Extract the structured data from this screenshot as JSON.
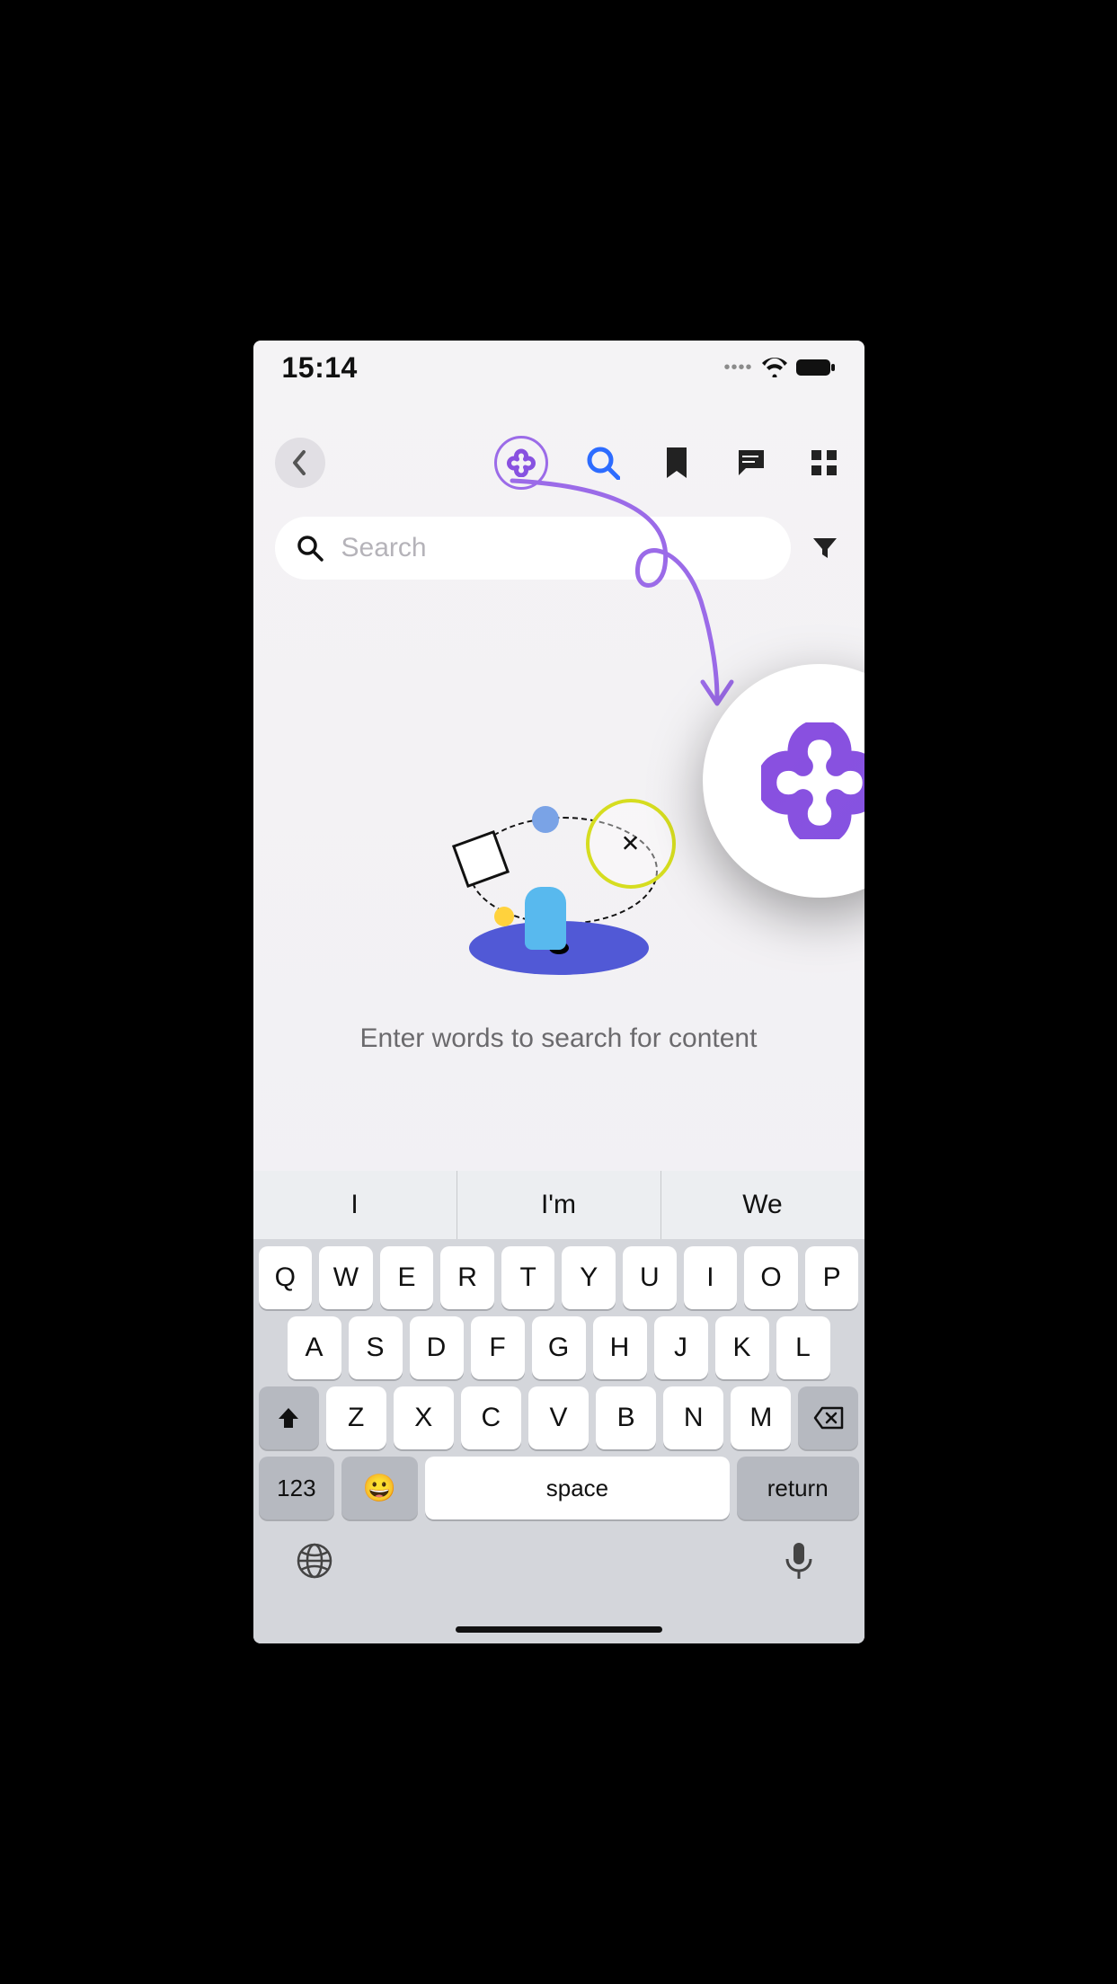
{
  "status": {
    "time": "15:14"
  },
  "toolbar": {
    "back_aria": "Back",
    "ai_aria": "AI",
    "search_aria": "Search",
    "bookmark_aria": "Bookmarks",
    "comments_aria": "Comments",
    "grid_aria": "Apps"
  },
  "search": {
    "placeholder": "Search",
    "value": "",
    "filter_aria": "Filter"
  },
  "empty_state": {
    "message": "Enter words to search for content"
  },
  "keyboard": {
    "suggestions": [
      "I",
      "I'm",
      "We"
    ],
    "row1": [
      "Q",
      "W",
      "E",
      "R",
      "T",
      "Y",
      "U",
      "I",
      "O",
      "P"
    ],
    "row2": [
      "A",
      "S",
      "D",
      "F",
      "G",
      "H",
      "J",
      "K",
      "L"
    ],
    "row3": [
      "Z",
      "X",
      "C",
      "V",
      "B",
      "N",
      "M"
    ],
    "numbers_label": "123",
    "space_label": "space",
    "return_label": "return"
  }
}
